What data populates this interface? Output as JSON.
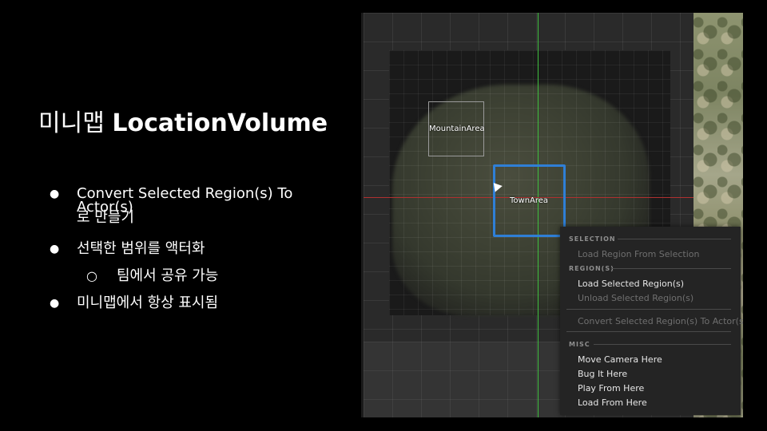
{
  "slide": {
    "title_korean": "미니맵",
    "title_english": "LocationVolume",
    "bullets": [
      {
        "marker": "●",
        "line1": "Convert Selected Region(s) To",
        "line2": "Actor(s)",
        "line3": "로 만들기"
      },
      {
        "marker": "●",
        "text": "선택한 범위를 액터화"
      },
      {
        "marker": "○",
        "text": "팀에서 공유 가능"
      },
      {
        "marker": "●",
        "text": "미니맵에서 항상 표시됨"
      }
    ]
  },
  "editor": {
    "regions": [
      {
        "label": "MountainArea"
      },
      {
        "label": "TownArea"
      }
    ],
    "colors": {
      "axis_x": "#b03030",
      "axis_y": "#3fbf3f",
      "selected_region": "#2f7fd6"
    },
    "context_menu": {
      "sections": [
        {
          "header": "SELECTION",
          "items": [
            {
              "label": "Load Region From Selection",
              "enabled": false
            }
          ]
        },
        {
          "header": "REGION(S)",
          "items": [
            {
              "label": "Load Selected Region(s)",
              "enabled": true
            },
            {
              "label": "Unload Selected Region(s)",
              "enabled": false
            },
            {
              "label": "Convert Selected Region(s) To Actor(s)",
              "enabled": false
            }
          ]
        },
        {
          "header": "MISC",
          "items": [
            {
              "label": "Move Camera Here",
              "enabled": true
            },
            {
              "label": "Bug It Here",
              "enabled": true
            },
            {
              "label": "Play From Here",
              "enabled": true
            },
            {
              "label": "Load From Here",
              "enabled": true
            }
          ]
        }
      ]
    }
  }
}
